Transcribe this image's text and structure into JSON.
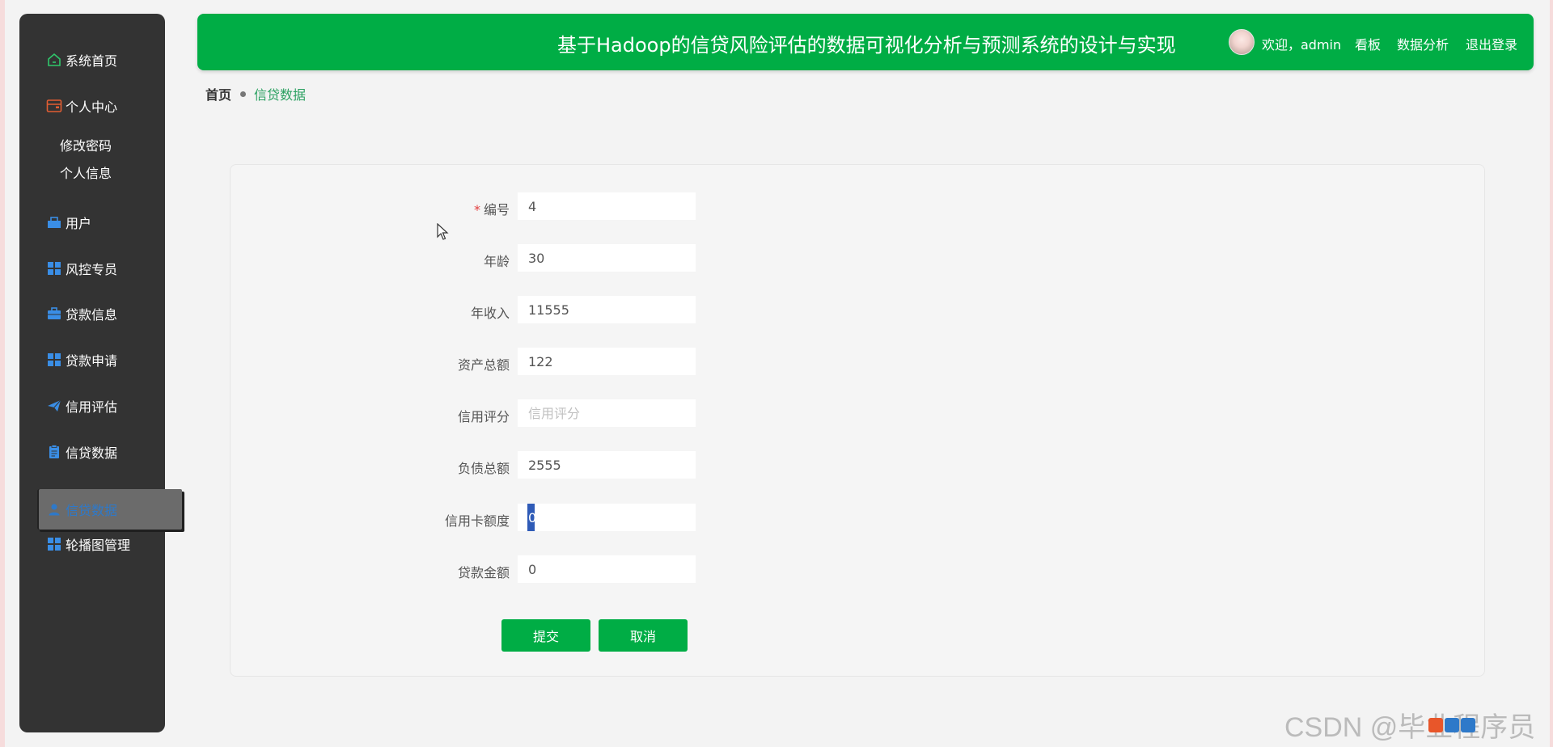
{
  "header": {
    "title": "基于Hadoop的信贷风险评估的数据可视化分析与预测系统的设计与实现",
    "welcome": "欢迎，admin",
    "links": [
      "看板",
      "数据分析",
      "退出登录"
    ]
  },
  "sidebar": {
    "items": [
      {
        "label": "系统首页",
        "icon": "home-icon"
      },
      {
        "label": "个人中心",
        "icon": "wallet-icon"
      },
      {
        "label": "修改密码"
      },
      {
        "label": "个人信息"
      },
      {
        "label": "用户",
        "icon": "user-box-icon"
      },
      {
        "label": "风控专员",
        "icon": "grid-icon"
      },
      {
        "label": "贷款信息",
        "icon": "briefcase-icon"
      },
      {
        "label": "贷款申请",
        "icon": "grid-icon"
      },
      {
        "label": "信用评估",
        "icon": "paper-plane-icon"
      },
      {
        "label": "信贷数据",
        "icon": "clipboard-icon"
      },
      {
        "label": "信贷数据",
        "icon": "person-icon",
        "active": true
      },
      {
        "label": "轮播图管理",
        "icon": "grid-icon"
      }
    ]
  },
  "breadcrumb": {
    "home": "首页",
    "current": "信贷数据"
  },
  "form": {
    "fields": [
      {
        "label": "编号",
        "required": true,
        "value": "4",
        "placeholder": "编号"
      },
      {
        "label": "年龄",
        "value": "30",
        "placeholder": "年龄"
      },
      {
        "label": "年收入",
        "value": "11555",
        "placeholder": "年收入"
      },
      {
        "label": "资产总额",
        "value": "122",
        "placeholder": "资产总额"
      },
      {
        "label": "信用评分",
        "value": "",
        "placeholder": "信用评分"
      },
      {
        "label": "负债总额",
        "value": "2555",
        "placeholder": "负债总额"
      },
      {
        "label": "信用卡额度",
        "value": "0",
        "placeholder": "信用卡额度"
      },
      {
        "label": "贷款金额",
        "value": "0",
        "placeholder": "贷款金额"
      }
    ],
    "submit_label": "提交",
    "cancel_label": "取消"
  },
  "watermark": "CSDN @毕业程序员",
  "colors": {
    "accent": "#00ad45",
    "sidebar": "#333333",
    "active_text": "#2e79c9"
  }
}
